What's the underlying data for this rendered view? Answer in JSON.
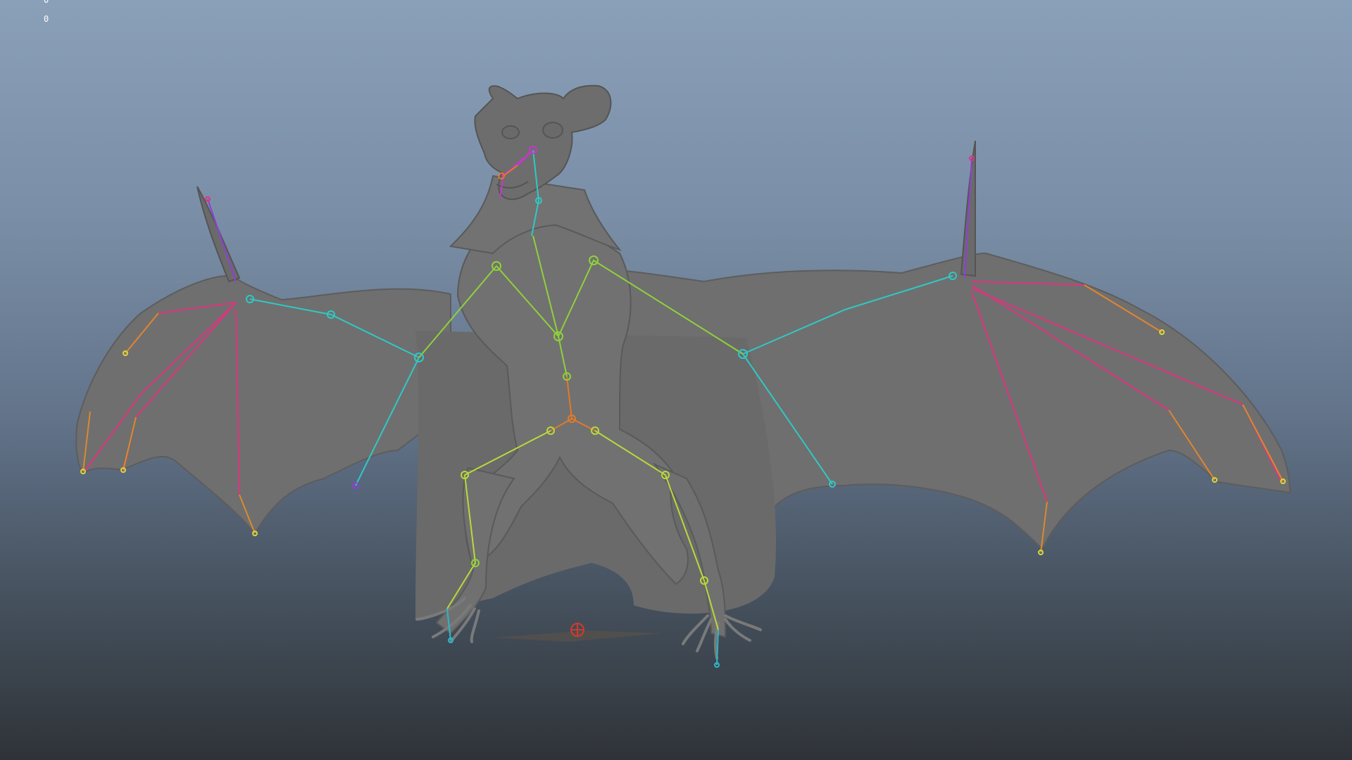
{
  "viewport": {
    "hud_values": [
      "0",
      "0"
    ]
  },
  "scene": {
    "model": "bat",
    "rig": "joint-skeleton",
    "mesh_color": "#6f6f6f",
    "background_top": "#8aa0b8",
    "background_bottom": "#2f3338"
  },
  "joint_colors": {
    "arm": "#2fc9c4",
    "wing_finger": "#e0347f",
    "wing_tip": "#d98a2e",
    "thumb": "#8e3fd6",
    "spine": "#8fd13a",
    "leg": "#b8d93a",
    "pelvis": "#e07a2a",
    "head": "#c438c9",
    "foot": "#2ab8c8",
    "root": "#d23a2a"
  }
}
